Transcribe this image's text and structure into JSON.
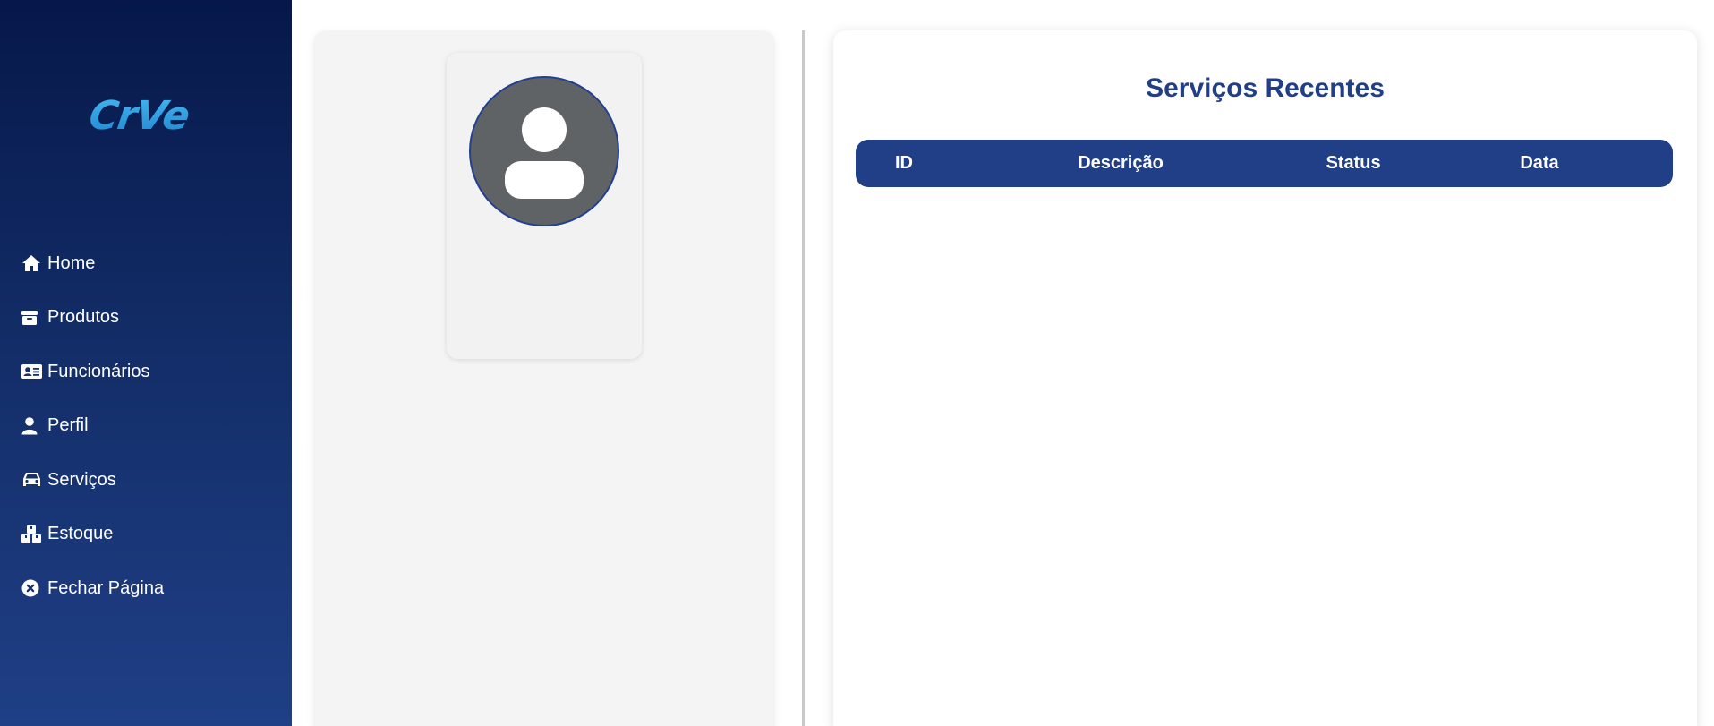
{
  "brand": {
    "logo_text": "CrVe",
    "colors": {
      "sidebar_top": "#06184a",
      "sidebar_bottom": "#1f3f86",
      "accent": "#213f86",
      "logo": "#2a9be0"
    }
  },
  "sidebar": {
    "items": [
      {
        "label": "Home",
        "icon": "home-icon"
      },
      {
        "label": "Produtos",
        "icon": "box-icon"
      },
      {
        "label": "Funcionários",
        "icon": "id-card-icon"
      },
      {
        "label": "Perfil",
        "icon": "user-icon"
      },
      {
        "label": "Serviços",
        "icon": "car-icon"
      },
      {
        "label": "Estoque",
        "icon": "boxes-icon"
      },
      {
        "label": "Fechar Página",
        "icon": "close-circle-icon"
      }
    ]
  },
  "profile": {
    "avatar_icon": "user-avatar-icon"
  },
  "services": {
    "title": "Serviços Recentes",
    "columns": [
      "ID",
      "Descrição",
      "Status",
      "Data"
    ],
    "rows": []
  }
}
